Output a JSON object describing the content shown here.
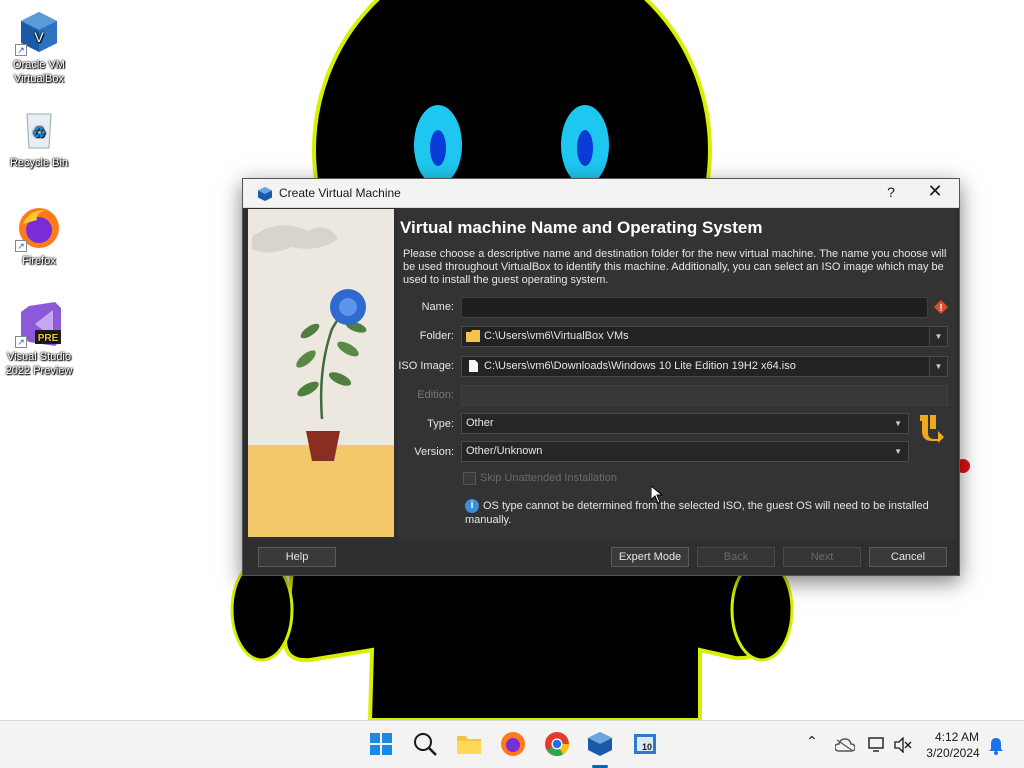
{
  "desktop": {
    "icons": [
      {
        "label": "Oracle VM VirtualBox"
      },
      {
        "label": "Recycle Bin"
      },
      {
        "label": "Firefox"
      },
      {
        "label": "Visual Studio 2022 Preview",
        "badge": "PRE"
      }
    ]
  },
  "dialog": {
    "title": "Create Virtual Machine",
    "help_glyph": "?",
    "close_glyph": "✕",
    "page_title": "Virtual machine Name and Operating System",
    "description": "Please choose a descriptive name and destination folder for the new virtual machine. The name you choose will be used throughout VirtualBox to identify this machine. Additionally, you can select an ISO image which may be used to install the guest operating system.",
    "fields": {
      "name": {
        "label": "Name:",
        "value": ""
      },
      "folder": {
        "label": "Folder:",
        "value": "C:\\Users\\vm6\\VirtualBox VMs"
      },
      "iso": {
        "label": "ISO Image:",
        "value": "C:\\Users\\vm6\\Downloads\\Windows 10 Lite Edition 19H2 x64.iso"
      },
      "edition": {
        "label": "Edition:",
        "value": ""
      },
      "type": {
        "label": "Type:",
        "value": "Other"
      },
      "version": {
        "label": "Version:",
        "value": "Other/Unknown"
      }
    },
    "skip_unattended": {
      "label": "Skip Unattended Installation",
      "checked": false,
      "enabled": false
    },
    "info_message": "OS type cannot be determined from the selected ISO, the guest OS will need to be installed manually.",
    "buttons": {
      "help": "Help",
      "expert_mode": "Expert Mode",
      "back": "Back",
      "next": "Next",
      "cancel": "Cancel"
    }
  },
  "taskbar": {
    "apps": [
      "start",
      "search",
      "file-explorer",
      "firefox",
      "chrome",
      "virtualbox",
      "vm-app"
    ],
    "active_app": "virtualbox",
    "clock": {
      "time": "4:12 AM",
      "date": "3/20/2024"
    }
  }
}
